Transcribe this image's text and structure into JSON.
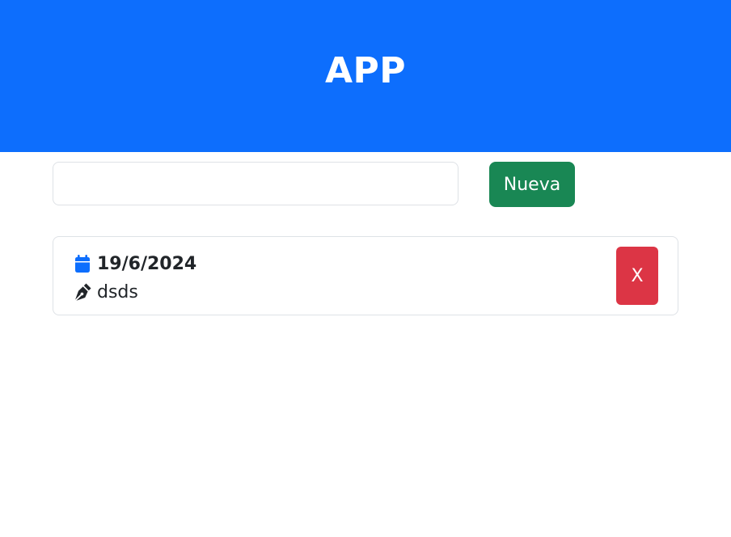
{
  "header": {
    "title": "APP"
  },
  "new_note": {
    "input_value": "",
    "input_placeholder": "",
    "button_label": "Nueva"
  },
  "notes": [
    {
      "date": "19/6/2024",
      "text": "dsds",
      "date_icon": "calendar-icon",
      "text_icon": "pen-nib-icon",
      "delete_label": "X"
    }
  ],
  "colors": {
    "header_bg": "#0d6efd",
    "new_button_bg": "#198754",
    "delete_button_bg": "#dc3545",
    "calendar_icon": "#0d6efd"
  }
}
